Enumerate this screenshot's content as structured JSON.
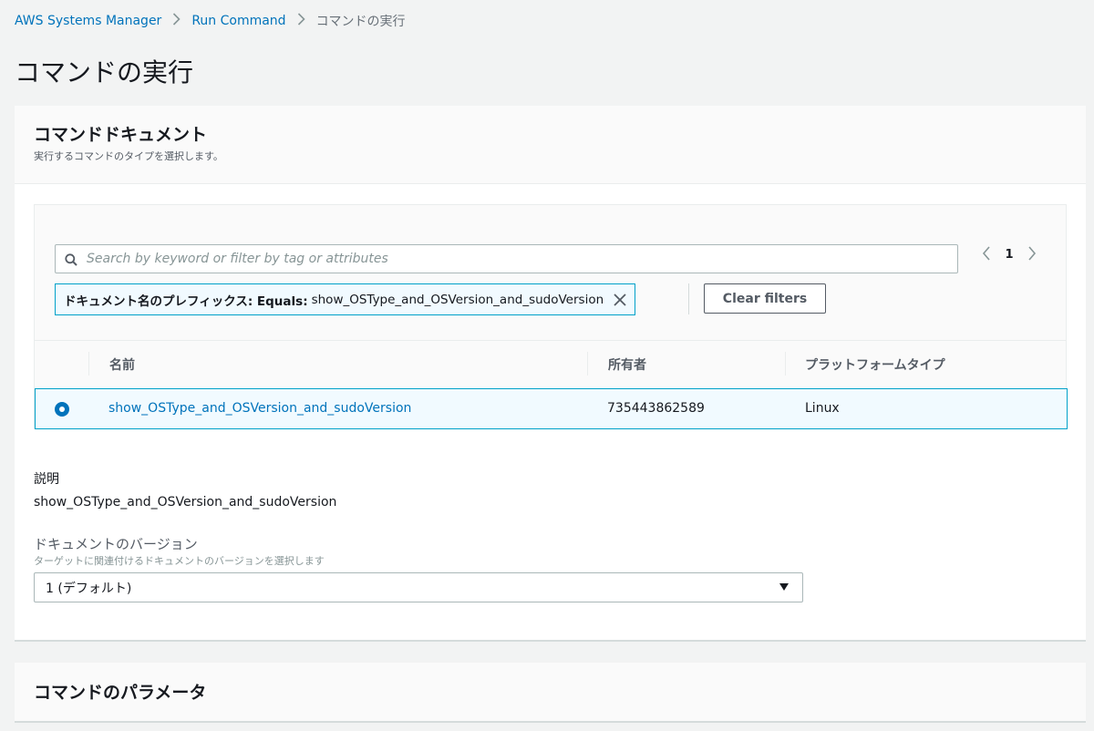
{
  "breadcrumb": {
    "items": [
      "AWS Systems Manager",
      "Run Command"
    ],
    "current": "コマンドの実行"
  },
  "page": {
    "title": "コマンドの実行"
  },
  "document_panel": {
    "title": "コマンドドキュメント",
    "description": "実行するコマンドのタイプを選択します。",
    "search": {
      "placeholder": "Search by keyword or filter by tag or attributes"
    },
    "pager": {
      "current": "1"
    },
    "filter": {
      "key": "ドキュメント名のプレフィックス: Equals:",
      "value": "show_OSType_and_OSVersion_and_sudoVersion"
    },
    "clear_filters_label": "Clear filters",
    "table": {
      "columns": [
        "名前",
        "所有者",
        "プラットフォームタイプ"
      ],
      "rows": [
        {
          "name": "show_OSType_and_OSVersion_and_sudoVersion",
          "owner": "735443862589",
          "platform": "Linux",
          "selected": true
        }
      ]
    },
    "description_label": "説明",
    "description_value": "show_OSType_and_OSVersion_and_sudoVersion",
    "version_label": "ドキュメントのバージョン",
    "version_hint": "ターゲットに関連付けるドキュメントのバージョンを選択します",
    "version_selected": "1 (デフォルト)"
  },
  "parameters_panel": {
    "title": "コマンドのパラメータ"
  },
  "colors": {
    "link": "#0073bb",
    "selected_row_bg": "#f1faff",
    "selected_border": "#00a1c9",
    "page_bg": "#f2f3f3"
  },
  "icons": [
    "chevron-right-icon",
    "search-icon",
    "chevron-left-icon",
    "close-icon",
    "caret-down-icon"
  ]
}
